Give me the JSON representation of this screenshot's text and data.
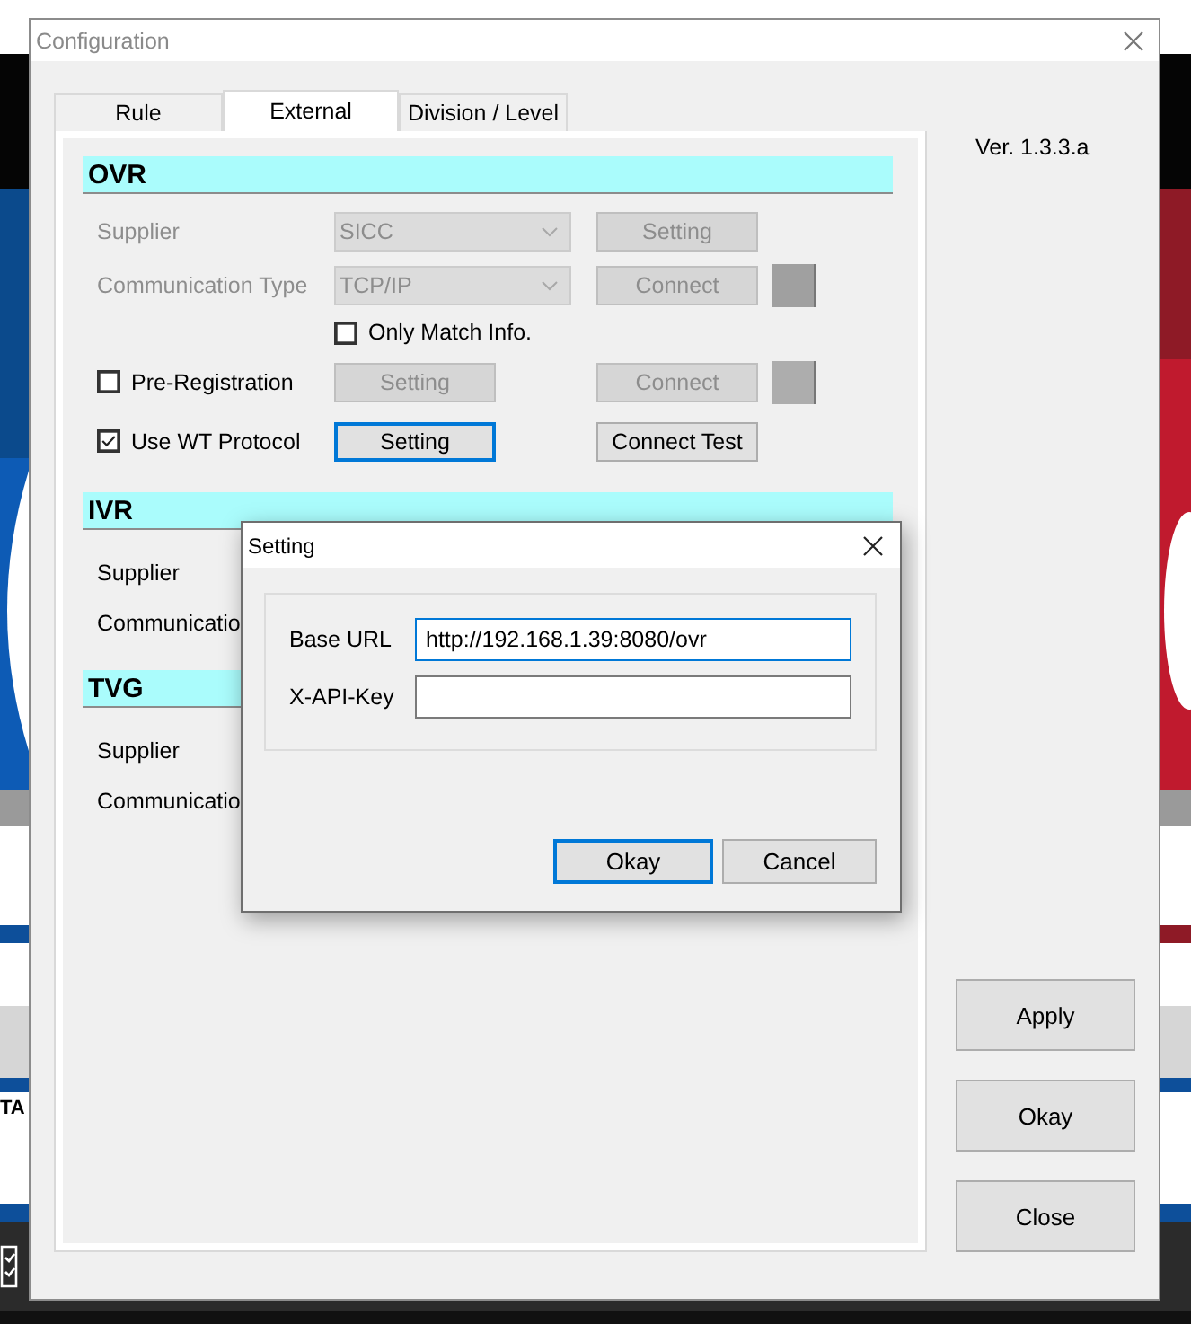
{
  "background_app": {
    "column_fragment": "TA"
  },
  "window": {
    "title": "Configuration",
    "version": "Ver. 1.3.3.a"
  },
  "tabs": [
    {
      "label": "Rule",
      "selected": false
    },
    {
      "label": "External",
      "selected": true
    },
    {
      "label": "Division / Level",
      "selected": false
    }
  ],
  "sections": [
    {
      "title": "OVR",
      "rows": [
        {
          "kind": "select",
          "label": "Supplier",
          "disabled": true,
          "value": "SICC",
          "button": {
            "label": "Setting",
            "disabled": true,
            "focused": false
          }
        },
        {
          "kind": "select",
          "label": "Communication Type",
          "disabled": true,
          "value": "TCP/IP",
          "action": {
            "label": "Connect",
            "disabled": true,
            "focused": false
          },
          "color": "#a0a0a0"
        },
        {
          "kind": "option",
          "label": "Only Match Info.",
          "checked": false
        },
        {
          "kind": "check",
          "label": "Pre-Registration",
          "checked": false,
          "button": {
            "label": "Setting",
            "disabled": true,
            "focused": false
          },
          "action": {
            "label": "Connect",
            "disabled": true,
            "focused": false
          },
          "color": "#adadad"
        },
        {
          "kind": "check",
          "label": "Use WT Protocol",
          "checked": true,
          "button": {
            "label": "Setting",
            "disabled": false,
            "focused": true
          },
          "action": {
            "label": "Connect Test",
            "disabled": false,
            "focused": false
          }
        }
      ]
    },
    {
      "title": "IVR",
      "rows": [
        {
          "kind": "label",
          "label": "Supplier"
        },
        {
          "kind": "label",
          "label": "Communicatio"
        }
      ]
    },
    {
      "title": "TVG",
      "rows": [
        {
          "kind": "label",
          "label": "Supplier"
        },
        {
          "kind": "label",
          "label": "Communicatio"
        }
      ]
    }
  ],
  "buttons": [
    "Apply",
    "Okay",
    "Close"
  ],
  "dialog": {
    "title": "Setting",
    "fields": [
      {
        "label": "Base URL",
        "value": "http://192.168.1.39:8080/ovr",
        "focused": true
      },
      {
        "label": "X-API-Key",
        "focused": false
      }
    ],
    "buttons": [
      {
        "label": "Okay",
        "focused": true
      },
      {
        "label": "Cancel",
        "focused": false
      }
    ]
  }
}
